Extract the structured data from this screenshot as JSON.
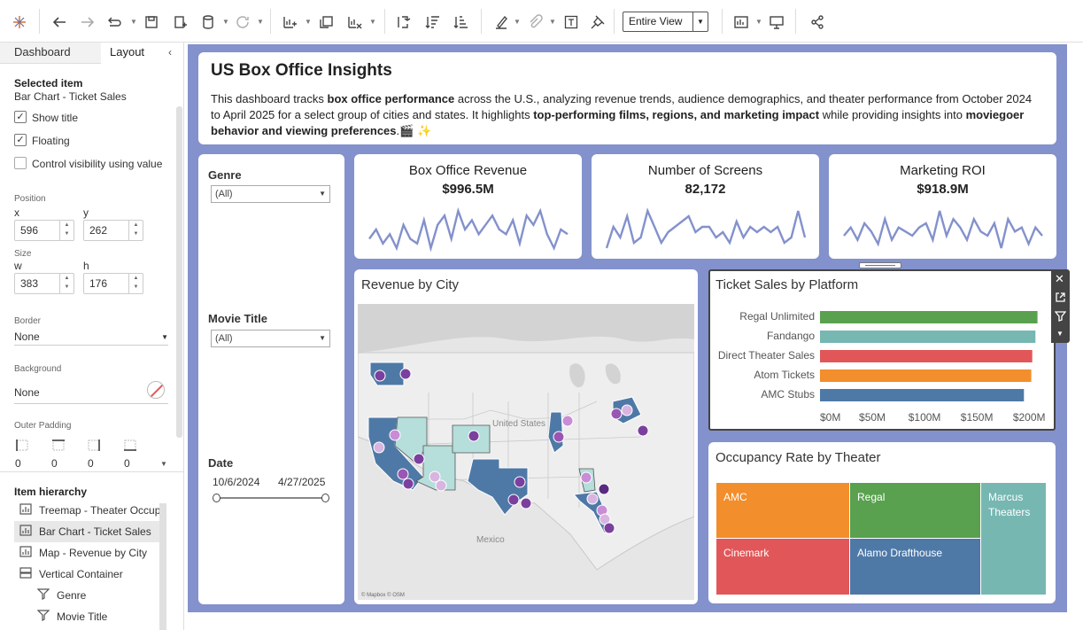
{
  "toolbar": {
    "view_select": "Entire View"
  },
  "panel": {
    "tabs": [
      "Dashboard",
      "Layout"
    ],
    "selected_item_label": "Selected item",
    "selected_item_name": "Bar Chart - Ticket Sales",
    "show_title_label": "Show title",
    "show_title_checked": true,
    "floating_label": "Floating",
    "floating_checked": true,
    "visibility_label": "Control visibility using value",
    "visibility_checked": false,
    "position_label": "Position",
    "x_label": "x",
    "x_value": "596",
    "y_label": "y",
    "y_value": "262",
    "size_label": "Size",
    "w_label": "w",
    "w_value": "383",
    "h_label": "h",
    "h_value": "176",
    "border_label": "Border",
    "border_value": "None",
    "background_label": "Background",
    "background_value": "None",
    "outer_padding_label": "Outer Padding",
    "padding_values": [
      "0",
      "0",
      "0",
      "0"
    ],
    "hierarchy_title": "Item hierarchy",
    "hierarchy": [
      {
        "label": "Treemap - Theater Occupancy Rate",
        "icon": "chart-icon"
      },
      {
        "label": "Bar Chart - Ticket Sales",
        "icon": "chart-icon",
        "selected": true
      },
      {
        "label": "Map - Revenue by City",
        "icon": "chart-icon"
      },
      {
        "label": "Vertical Container",
        "icon": "container-icon"
      },
      {
        "label": "Genre",
        "icon": "filter-icon"
      },
      {
        "label": "Movie Title",
        "icon": "filter-icon"
      }
    ]
  },
  "dashboard": {
    "title": "US Box Office Insights",
    "desc": [
      {
        "t": "This dashboard tracks ",
        "b": false
      },
      {
        "t": "box office performance",
        "b": true
      },
      {
        "t": " across the U.S., analyzing revenue trends, audience demographics, and theater performance from October 2024 to April 2025 for a select group of cities and states. It highlights ",
        "b": false
      },
      {
        "t": "top-performing films, regions, and marketing impact",
        "b": true
      },
      {
        "t": " while providing insights into ",
        "b": false
      },
      {
        "t": "moviegoer behavior and viewing preferences",
        "b": true
      },
      {
        "t": ".🎬 ✨",
        "b": false
      }
    ]
  },
  "filters": {
    "genre_label": "Genre",
    "genre_value": "(All)",
    "movie_label": "Movie Title",
    "movie_value": "(All)",
    "date_label": "Date",
    "date_start": "10/6/2024",
    "date_end": "4/27/2025"
  },
  "kpis": [
    {
      "title": "Box Office Revenue",
      "value": "$996.5M",
      "spark": [
        3,
        5,
        2,
        4,
        1,
        6,
        3,
        2,
        7,
        1,
        6,
        8,
        3,
        9,
        5,
        7,
        4,
        6,
        8,
        5,
        4,
        7,
        2,
        8,
        6,
        9,
        4,
        1,
        5,
        4
      ]
    },
    {
      "title": "Number of Screens",
      "value": "82,172",
      "spark": [
        2,
        6,
        4,
        8,
        3,
        4,
        9,
        6,
        3,
        5,
        6,
        7,
        8,
        5,
        6,
        6,
        4,
        5,
        3,
        7,
        4,
        6,
        5,
        6,
        5,
        6,
        3,
        4,
        9,
        4
      ]
    },
    {
      "title": "Marketing ROI",
      "value": "$918.9M",
      "spark": [
        4,
        6,
        3,
        7,
        5,
        2,
        8,
        3,
        6,
        5,
        4,
        6,
        7,
        3,
        10,
        4,
        8,
        6,
        3,
        8,
        5,
        4,
        7,
        1,
        8,
        5,
        6,
        2,
        6,
        4
      ]
    }
  ],
  "map": {
    "title": "Revenue by City",
    "labels": {
      "us": "United States",
      "mx": "Mexico",
      "credit": "© Mapbox © OSM"
    }
  },
  "chart_data": {
    "type": "bar",
    "title": "Ticket Sales by Platform",
    "categories": [
      "Regal Unlimited",
      "Fandango",
      "Direct Theater Sales",
      "Atom Tickets",
      "AMC Stubs"
    ],
    "values": [
      208,
      206,
      203,
      202,
      195
    ],
    "colors": [
      "#59a14f",
      "#76b7b2",
      "#e15759",
      "#f28e2b",
      "#4e79a7"
    ],
    "xticks": [
      "$0M",
      "$50M",
      "$100M",
      "$150M",
      "$200M"
    ],
    "xlim": [
      0,
      210
    ],
    "grid": false,
    "legend": "none"
  },
  "treemap": {
    "title": "Occupancy Rate by Theater",
    "tiles": [
      {
        "label": "AMC",
        "color": "#f28e2b"
      },
      {
        "label": "Regal",
        "color": "#59a14f"
      },
      {
        "label": "Marcus Theaters",
        "color": "#76b7b2"
      },
      {
        "label": "Cinemark",
        "color": "#e15759"
      },
      {
        "label": "Alamo Drafthouse",
        "color": "#4e79a7"
      }
    ]
  }
}
